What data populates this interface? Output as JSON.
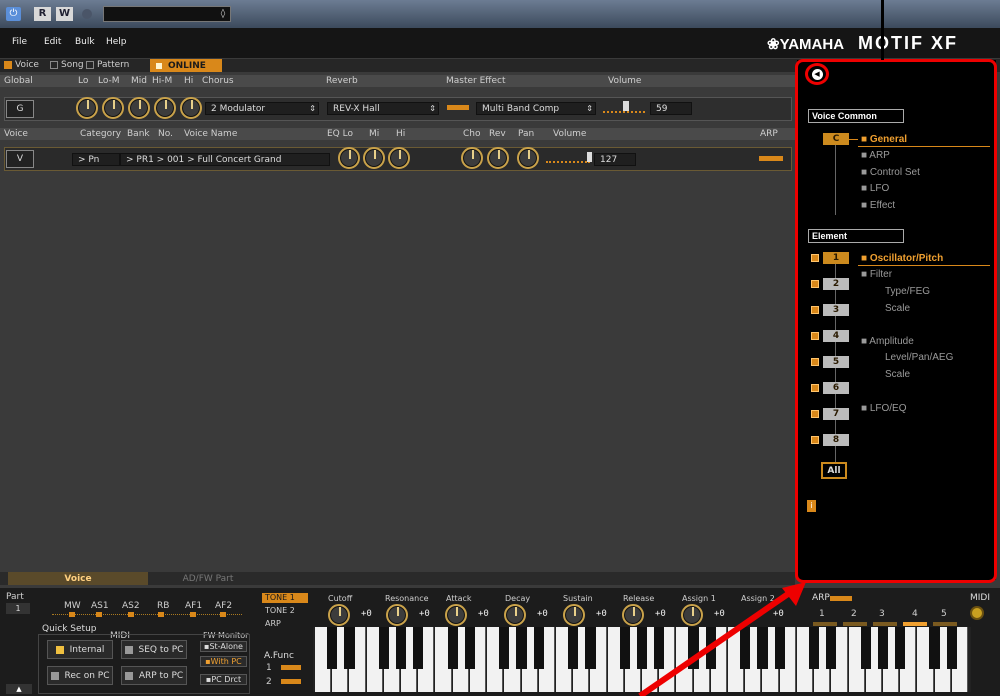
{
  "toolbar": {
    "r_label": "R",
    "w_label": "W"
  },
  "menu": [
    "File",
    "Edit",
    "Bulk",
    "Help"
  ],
  "brand": {
    "yamaha": "YAMAHA",
    "product": "MOTIF XF"
  },
  "modes": {
    "voice": "Voice",
    "song": "Song",
    "pattern": "Pattern",
    "online": "ONLINE"
  },
  "global": {
    "headers": {
      "global": "Global",
      "lo": "Lo",
      "lom": "Lo-M",
      "mid": "Mid",
      "him": "Hi-M",
      "hi": "Hi",
      "chorus": "Chorus",
      "reverb": "Reverb",
      "master": "Master Effect",
      "volume": "Volume"
    },
    "row": {
      "label": "G",
      "chorus": "2 Modulator",
      "reverb": "REV-X Hall",
      "master": "Multi Band Comp",
      "volume": "59"
    }
  },
  "voice": {
    "headers": {
      "voice": "Voice",
      "category": "Category",
      "bank": "Bank",
      "no": "No.",
      "name": "Voice Name",
      "eqlo": "EQ Lo",
      "mi": "Mi",
      "hi": "Hi",
      "cho": "Cho",
      "rev": "Rev",
      "pan": "Pan",
      "volume": "Volume",
      "arp": "ARP"
    },
    "row": {
      "label": "V",
      "category": "> Pn",
      "bank_no": "> PR1 > 001 > Full Concert Grand",
      "volume": "127"
    }
  },
  "right_panel": {
    "voice_common": "Voice Common",
    "common_btn": "C",
    "common_items": [
      "General",
      "ARP",
      "Control Set",
      "LFO",
      "Effect"
    ],
    "element": "Element",
    "element_buttons": [
      "1",
      "2",
      "3",
      "4",
      "5",
      "6",
      "7",
      "8"
    ],
    "element_items": [
      "Oscillator/Pitch",
      "Filter",
      "Type/FEG",
      "Scale",
      "Amplitude",
      "Level/Pan/AEG",
      "Scale",
      "LFO/EQ"
    ],
    "all_btn": "All",
    "info": "i"
  },
  "bottom": {
    "tabs": [
      "Voice",
      "AD/FW Part"
    ],
    "part_label": "Part",
    "part_value": "1",
    "assign_headers": [
      "MW",
      "AS1",
      "AS2",
      "RB",
      "AF1",
      "AF2"
    ],
    "quick_setup": "Quick Setup",
    "midi": "MIDI",
    "fw_monitor": "FW Monitor",
    "buttons": [
      "Internal",
      "SEQ to PC",
      "Rec on PC",
      "ARP to PC"
    ],
    "fw_buttons": [
      "St-Alone",
      "With PC",
      "PC Drct"
    ],
    "tones": [
      "TONE 1",
      "TONE 2",
      "ARP"
    ],
    "knob_labels": [
      "Cutoff",
      "Resonance",
      "Attack",
      "Decay",
      "Sustain",
      "Release",
      "Assign 1",
      "Assign 2"
    ],
    "knob_value": "+0",
    "afunc": "A.Func",
    "afunc_nums": [
      "1",
      "2"
    ],
    "arp": "ARP",
    "arp_nums": [
      "1",
      "2",
      "3",
      "4",
      "5"
    ],
    "midi_label": "MIDI"
  },
  "colors": {
    "accent": "#d9881a",
    "frame": "#e00000",
    "panel": "#000000"
  }
}
